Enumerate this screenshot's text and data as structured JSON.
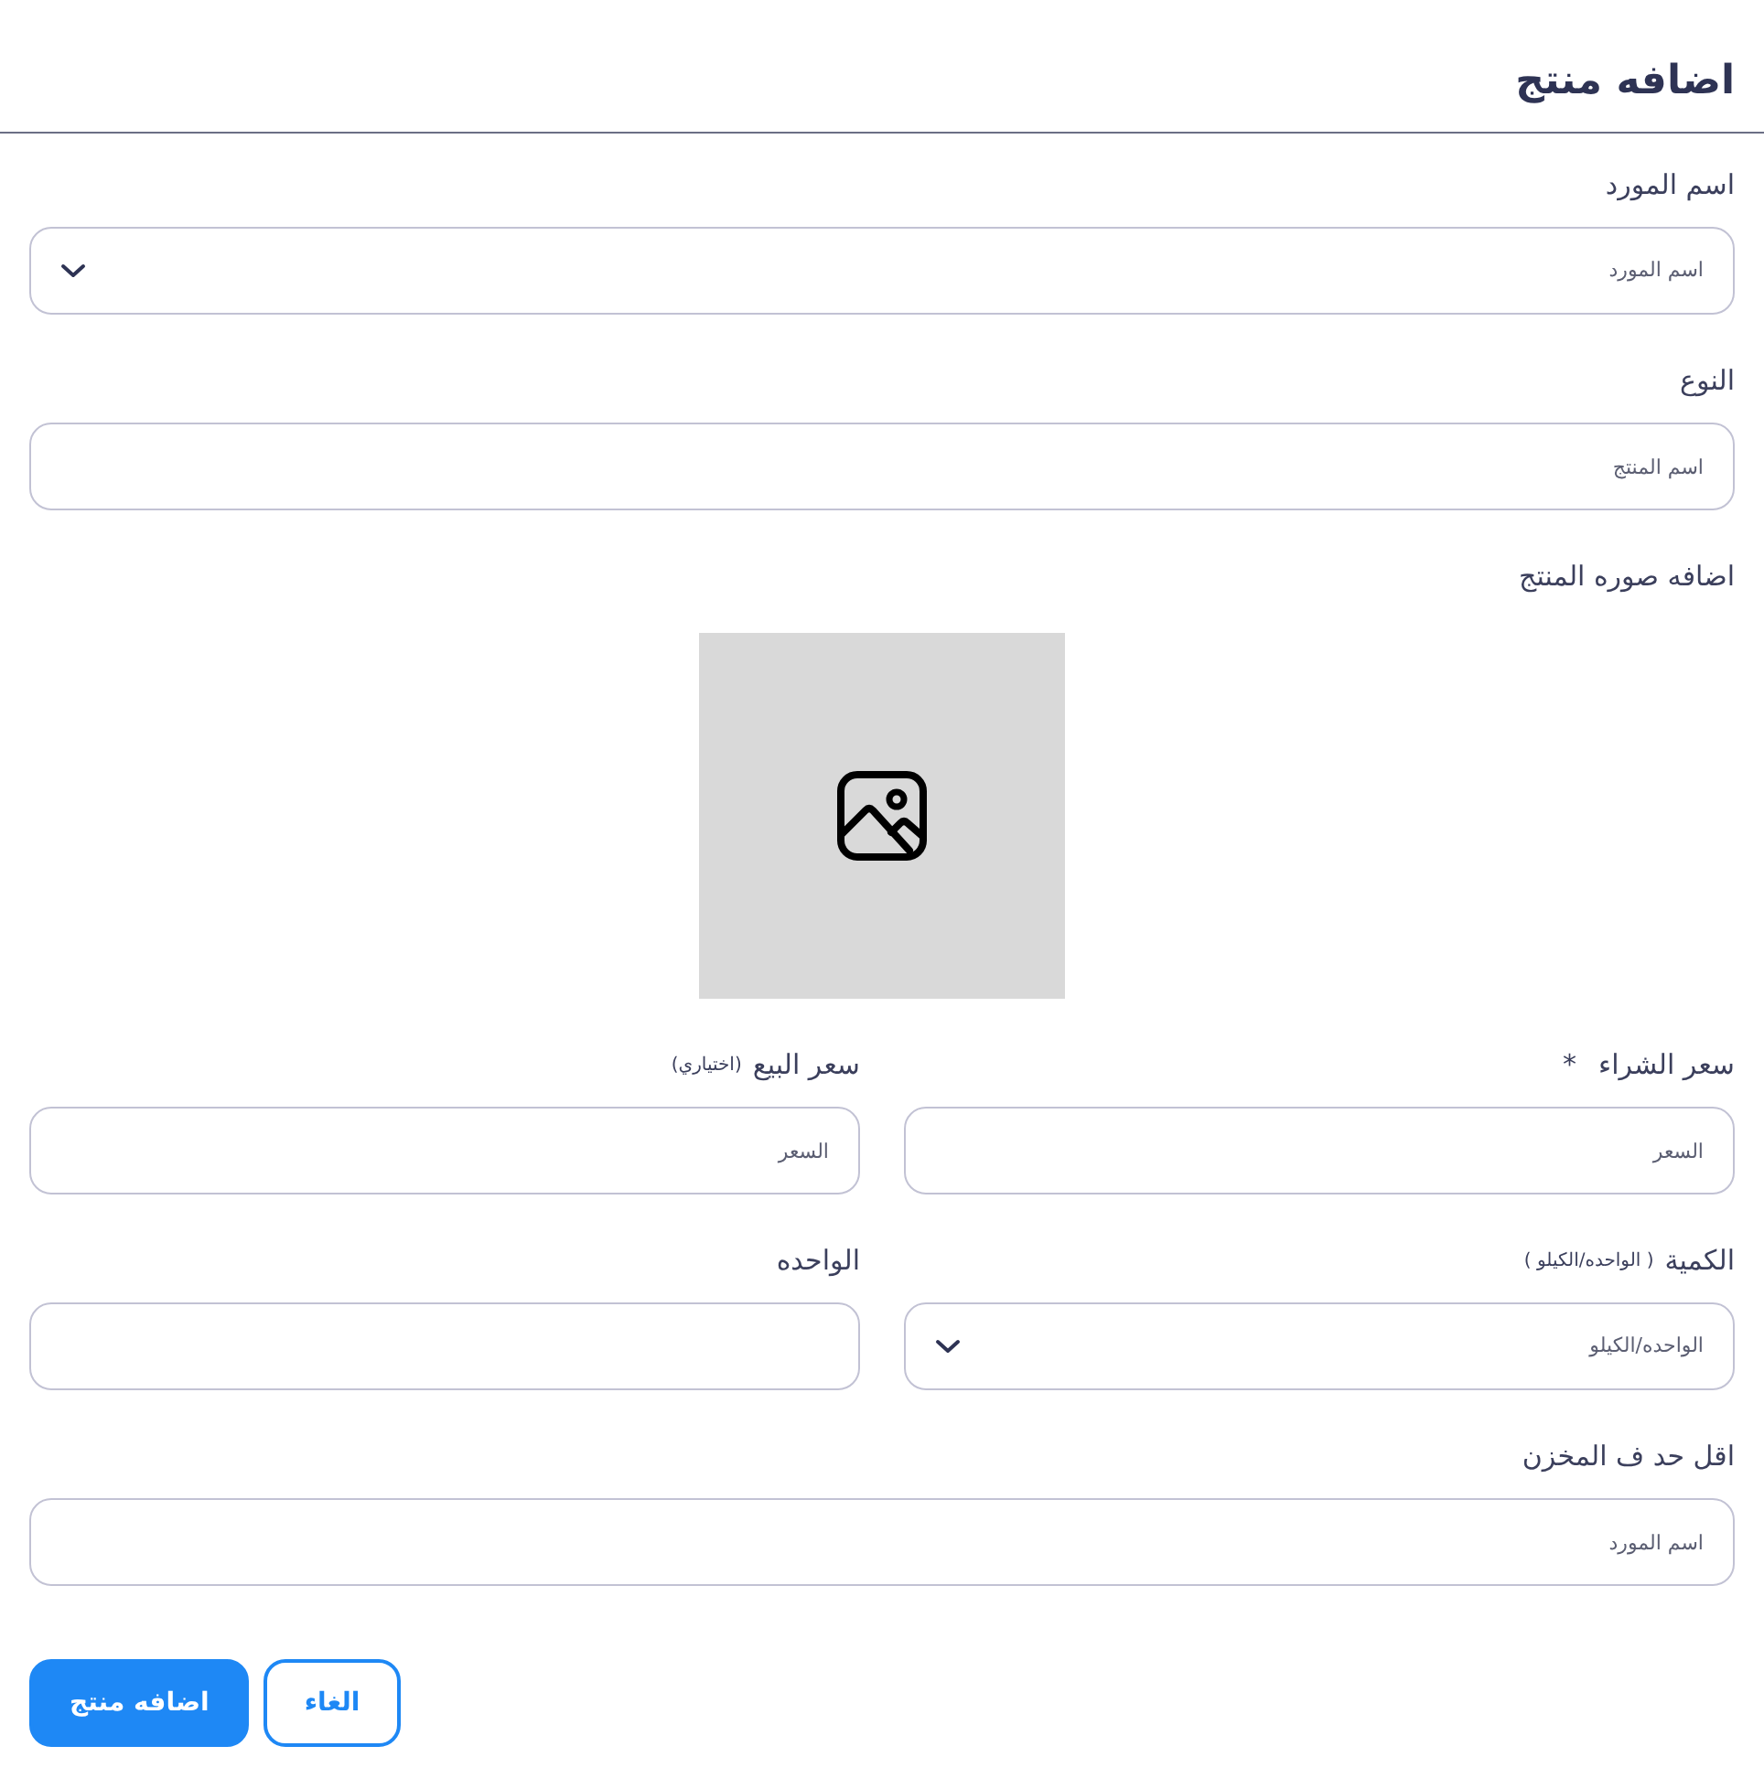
{
  "header": {
    "title": "اضافه منتج"
  },
  "form": {
    "rows": [
      {
        "fields": [
          {
            "kind": "select",
            "label": {
              "text": "اسم المورد"
            },
            "placeholder": "اسم المورد"
          }
        ]
      },
      {
        "fields": [
          {
            "kind": "text",
            "label": {
              "text": "النوع"
            },
            "placeholder": "اسم المنتج"
          }
        ]
      },
      {
        "fields": [
          {
            "kind": "image",
            "label": {
              "text": "اضافه صوره المنتج"
            }
          }
        ]
      },
      {
        "fields": [
          {
            "kind": "text",
            "label": {
              "text": "سعر الشراء",
              "required_mark": "*"
            },
            "placeholder": "السعر"
          },
          {
            "kind": "text",
            "label": {
              "text": "سعر البيع",
              "note": "(اختياري)"
            },
            "placeholder": "السعر"
          }
        ]
      },
      {
        "fields": [
          {
            "kind": "select",
            "label": {
              "text": "الكمية",
              "note": "( الواحده/الكيلو )"
            },
            "placeholder": "الواحده/الكيلو"
          },
          {
            "kind": "text",
            "label": {
              "text": "الواحده"
            }
          }
        ]
      },
      {
        "fields": [
          {
            "kind": "text",
            "label": {
              "text": "اقل حد ف المخزن"
            },
            "placeholder": "اسم المورد"
          }
        ]
      }
    ]
  },
  "buttons": [
    {
      "kind": "outline",
      "label": "الغاء"
    },
    {
      "kind": "primary",
      "label": "اضافه منتج"
    }
  ]
}
